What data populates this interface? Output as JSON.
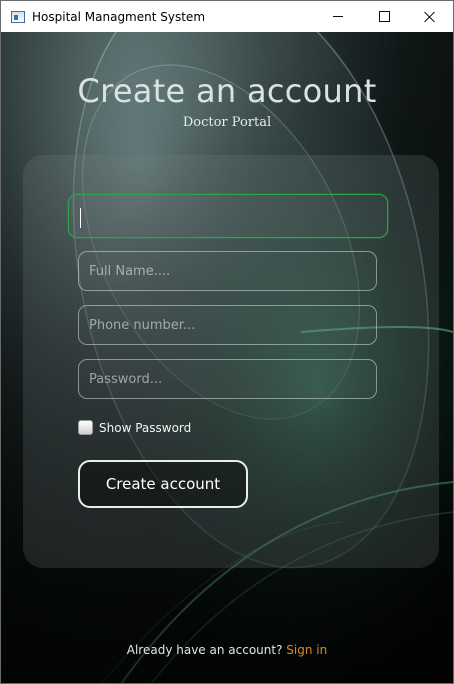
{
  "window": {
    "title": "Hospital Managment System"
  },
  "header": {
    "title": "Create an account",
    "subtitle": "Doctor Portal"
  },
  "form": {
    "first_field": {
      "value": "",
      "placeholder": ""
    },
    "full_name": {
      "value": "",
      "placeholder": "Full Name...."
    },
    "phone": {
      "value": "",
      "placeholder": "Phone number..."
    },
    "password": {
      "value": "",
      "placeholder": "Password..."
    },
    "show_password_label": "Show Password",
    "show_password_checked": false,
    "submit_label": "Create account"
  },
  "footer": {
    "prompt": "Already have an account?",
    "link": "Sign in"
  },
  "colors": {
    "focus_border": "#2fa34a",
    "link": "#e08a1e",
    "accent_glow": "#3fd08a"
  },
  "icons": {
    "app": "app-window-icon",
    "minimize": "minimize-icon",
    "maximize": "maximize-icon",
    "close": "close-icon"
  }
}
